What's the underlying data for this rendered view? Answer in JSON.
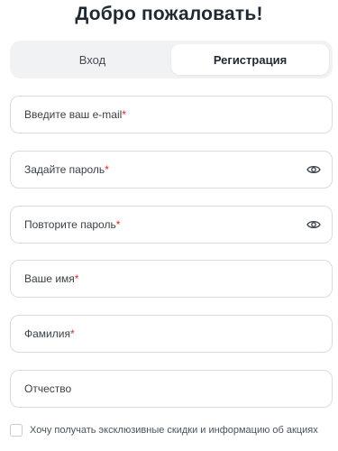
{
  "title": "Добро пожаловать!",
  "tabs": [
    {
      "label": "Вход",
      "active": false
    },
    {
      "label": "Регистрация",
      "active": true
    }
  ],
  "fields": {
    "email": {
      "label": "Введите ваш e-mail",
      "required": "*"
    },
    "password": {
      "label": "Задайте пароль",
      "required": "*"
    },
    "password_repeat": {
      "label": "Повторите пароль",
      "required": "*"
    },
    "first_name": {
      "label": "Ваше имя",
      "required": "*"
    },
    "last_name": {
      "label": "Фамилия",
      "required": "*"
    },
    "middle_name": {
      "label": "Отчество"
    }
  },
  "consent": {
    "label": "Хочу получать эксклюзивные скидки и информацию об акциях",
    "checked": false
  },
  "colors": {
    "required_mark": "#e02424",
    "border": "#d9dcdf",
    "tab_background": "#f1f2f3"
  },
  "icons": {
    "password_toggle": "eye-icon"
  }
}
